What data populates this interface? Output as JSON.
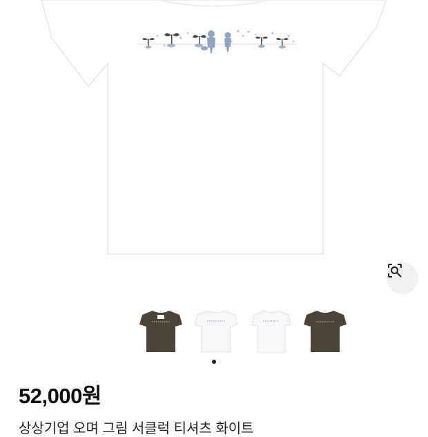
{
  "product": {
    "price": "52,000원",
    "title": "상상기업 오며 그림 서클럭 티셔츠 화이트"
  },
  "gallery": {
    "thumbnails": [
      {
        "name": "thumb-charcoal-front",
        "shirt_color": "#4b4336",
        "print_color": "#b9b2a4"
      },
      {
        "name": "thumb-white-front",
        "shirt_color": "#f7f7f7",
        "print_color": "#9aa8bd"
      },
      {
        "name": "thumb-white-alt",
        "shirt_color": "#f7f7f7",
        "print_color": "#9aa8bd"
      },
      {
        "name": "thumb-charcoal-alt",
        "shirt_color": "#4b4336",
        "print_color": "#b9b2a4"
      }
    ],
    "active_page": 1,
    "page_count": 1
  },
  "icons": {
    "visual_search": "lens-search-icon"
  },
  "colors": {
    "price_text": "#111111",
    "print_blue": "#8fa4c4",
    "print_dark": "#3d3d3d"
  }
}
